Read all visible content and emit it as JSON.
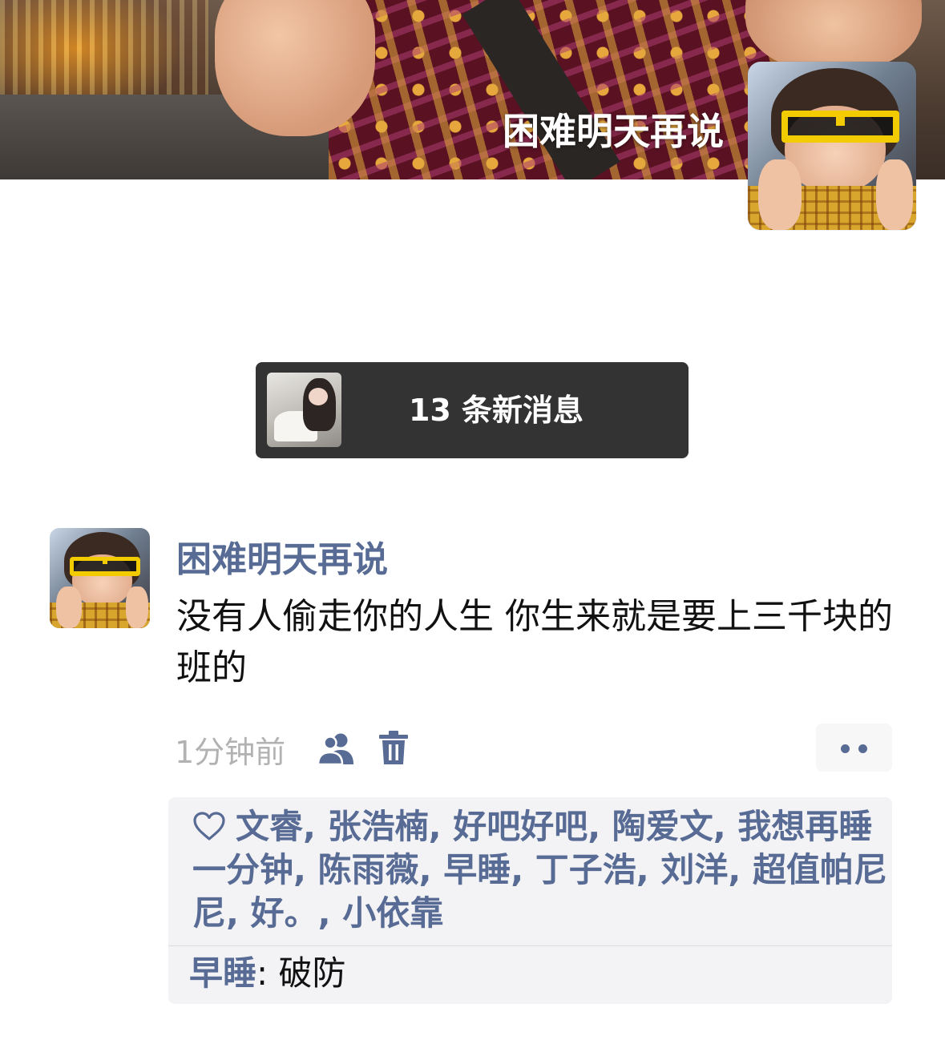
{
  "profile": {
    "name": "困难明天再说"
  },
  "notification": {
    "text": "13 条新消息"
  },
  "post": {
    "author": "困难明天再说",
    "content": "没有人偷走你的人生 你生来就是要上三千块的班的",
    "time": "1分钟前",
    "likes": [
      "文睿",
      "张浩楠",
      "好吧好吧",
      "陶爱文",
      "我想再睡一分钟",
      "陈雨薇",
      "早睡",
      "丁子浩",
      "刘洋",
      "超值帕尼尼",
      "好。",
      "小依靠"
    ],
    "like_separator": ", ",
    "comments": [
      {
        "author": "早睡",
        "colon": ": ",
        "text": "破防"
      }
    ]
  },
  "icons": {
    "like": "heart-outline-icon",
    "visibility": "friends-icon",
    "delete": "trash-icon",
    "more": "more-dots-icon"
  },
  "colors": {
    "name_link": "#576b95",
    "notice_bg": "#333333",
    "interaction_bg": "#f3f3f5",
    "time_gray": "#b2b2b2"
  }
}
